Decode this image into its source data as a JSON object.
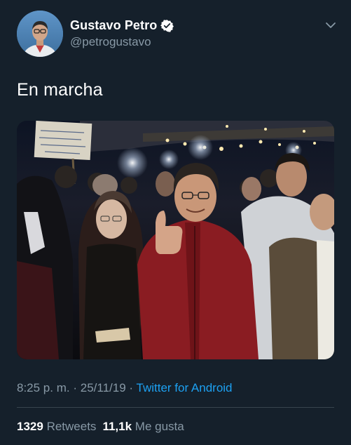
{
  "author": {
    "display_name": "Gustavo Petro",
    "handle": "@petrogustavo",
    "verified": true
  },
  "tweet": {
    "text": "En marcha"
  },
  "meta": {
    "time": "8:25 p. m.",
    "separator": "·",
    "date": "25/11/19",
    "source": "Twitter for Android"
  },
  "stats": {
    "retweets_count": "1329",
    "retweets_label": "Retweets",
    "likes_count": "11,1k",
    "likes_label": "Me gusta"
  },
  "colors": {
    "background": "#15202b",
    "secondary_text": "#8899a6",
    "accent": "#1da1f2",
    "divider": "#38444d"
  },
  "icons": {
    "verified": "verified-badge-icon",
    "menu": "chevron-down-icon"
  }
}
